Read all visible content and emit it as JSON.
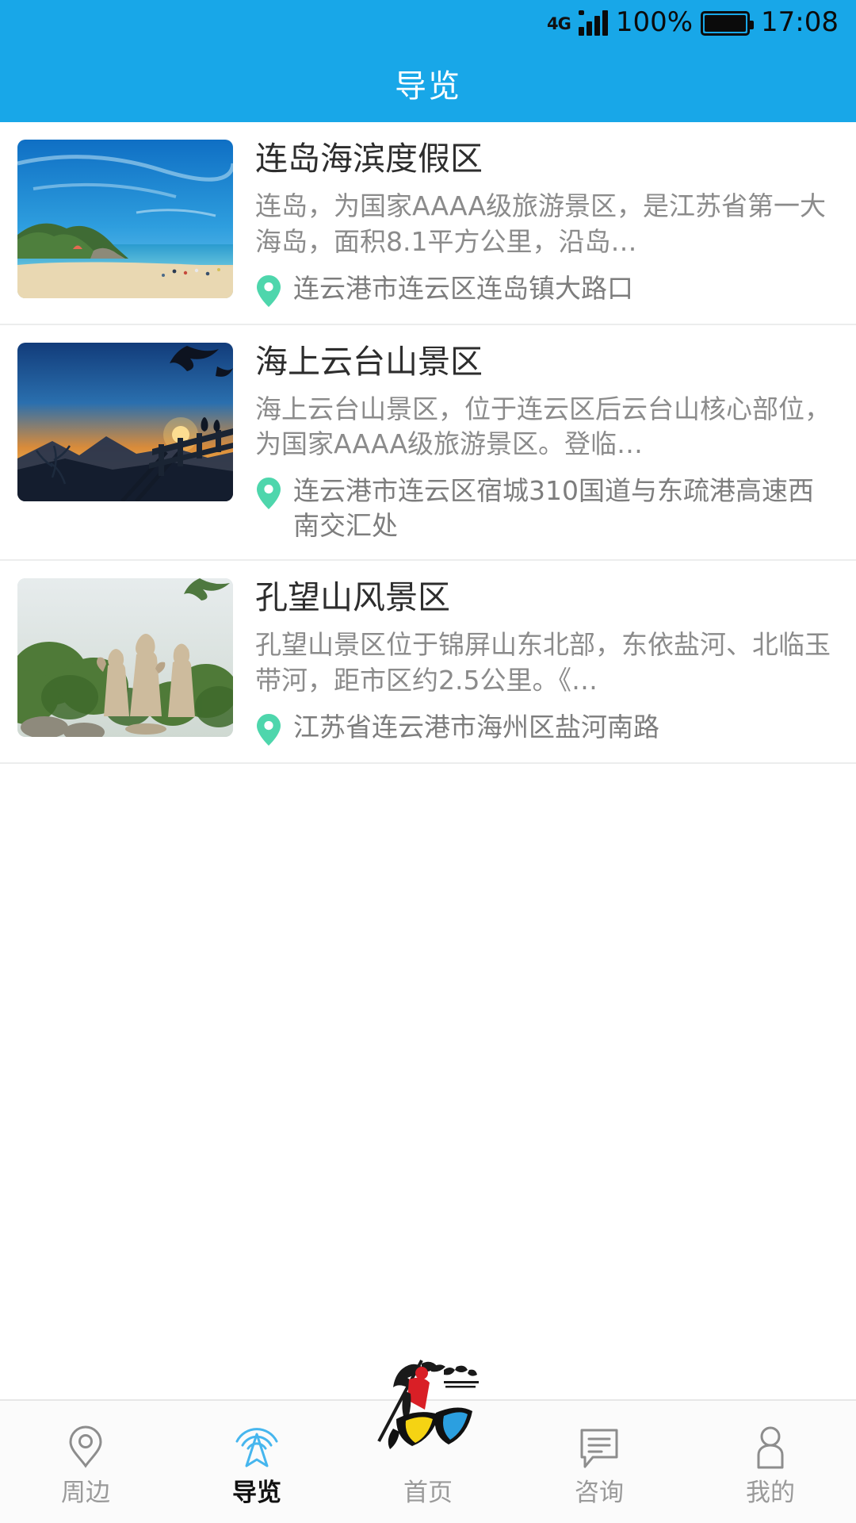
{
  "status_bar": {
    "network": "4G",
    "battery_percent": "100%",
    "time": "17:08",
    "signal_icon": "signal-bars-icon",
    "battery_icon": "battery-full-icon"
  },
  "header": {
    "title": "导览",
    "background_color": "#18A7E8",
    "text_color": "#FFFFFF"
  },
  "theme": {
    "accent": "#18A7E8",
    "pin_color": "#4ED6AC",
    "title_text": "#2D2D2D",
    "body_text": "#8B8B8B"
  },
  "list": {
    "items": [
      {
        "name": "连岛海滨度假区",
        "description": "连岛，为国家AAAA级旅游景区，是江苏省第一大海岛，面积8.1平方公里，沿岛…",
        "address": "连云港市连云区连岛镇大路口",
        "thumb_alt": "连岛海滨沙滩与蓝天白云",
        "pin_icon": "location-pin-icon"
      },
      {
        "name": "海上云台山景区",
        "description": "海上云台山景区，位于连云区后云台山核心部位，为国家AAAA级旅游景区。登临…",
        "address": "连云港市连云区宿城310国道与东疏港高速西南交汇处",
        "thumb_alt": "海上云台山日落观景栈道",
        "pin_icon": "location-pin-icon"
      },
      {
        "name": "孔望山风景区",
        "description": "孔望山景区位于锦屏山东北部，东依盐河、北临玉带河，距市区约2.5公里。《…",
        "address": "江苏省连云港市海州区盐河南路",
        "thumb_alt": "孔望山孔子石雕像群",
        "pin_icon": "location-pin-icon"
      }
    ]
  },
  "tabbar": {
    "active_index": 1,
    "items": [
      {
        "label": "周边",
        "icon": "map-pin-icon"
      },
      {
        "label": "导览",
        "icon": "radar-broadcast-icon"
      },
      {
        "label": "首页",
        "icon": "app-logo-icon"
      },
      {
        "label": "咨询",
        "icon": "chat-bubble-icon"
      },
      {
        "label": "我的",
        "icon": "user-person-icon"
      }
    ]
  }
}
